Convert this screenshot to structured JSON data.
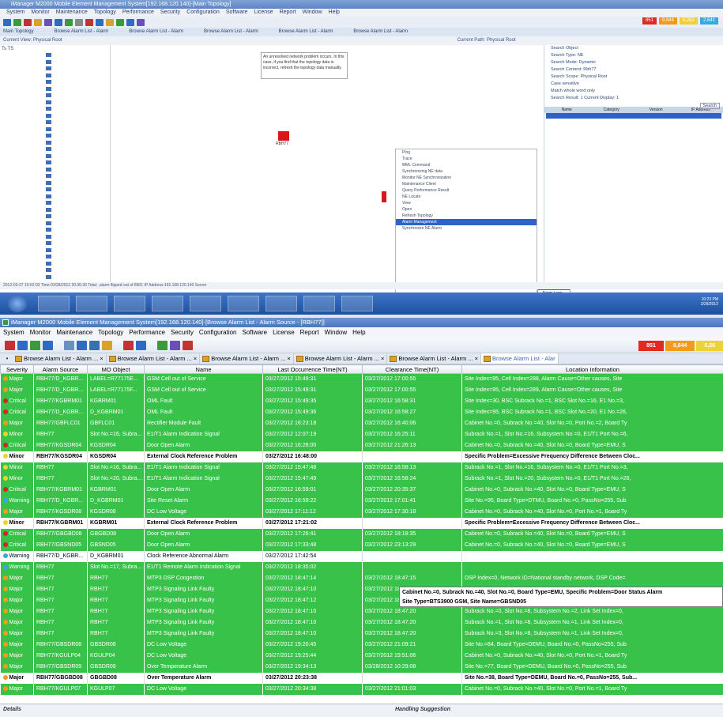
{
  "bg": {
    "title": "iManager M2000 Mobile Element Management System[192.168.120.140]-[Main Topology]",
    "menu": [
      "System",
      "Monitor",
      "Maintenance",
      "Topology",
      "Performance",
      "Security",
      "Configuration",
      "Software",
      "License",
      "Report",
      "Window",
      "Help"
    ],
    "counters": [
      "851",
      "9,844",
      "5,262",
      "2,641"
    ],
    "tabs": [
      "Main Topology",
      "Browse Alarm List - Alarm",
      "Browse Alarm List - Alarm",
      "Browse Alarm List - Alarm",
      "Browse Alarm List - Alarm",
      "Browse Alarm List - Alarm"
    ],
    "view_label": "Current View: Physical Root",
    "path_label": "Current Path: Physical Root",
    "note": "An unresolved network problem occurs. In this case, if you find that the topology data is incorrect, refresh the topology data manually.",
    "ne_label": "RBH77",
    "tree_root": "Ts TS",
    "ctx_items": [
      "Ping",
      "Trace",
      "MML Command",
      "Synchronizing NE data",
      "Monitor NE Synchronization",
      "Maintenance Client",
      "Query Performance Result",
      "NE Locate",
      "View",
      "Open",
      "Refresh Topology",
      "Alarm Management",
      "Synchronize NE Alarm"
    ],
    "submenu": [
      "Alarm List",
      "Alarm Logs",
      "Event Logs"
    ],
    "search_rows": [
      "Search Object",
      "Search Type: NE",
      "Search Mode: Dynamic",
      "Search Content: Rbh77",
      "Search Scope: Physical Root",
      "Case sensitive",
      "Match whole word only",
      "Search Result: 1  Current Display: 1"
    ],
    "search_button": "Search",
    "search_headers": [
      "Name",
      "Category",
      "Version",
      "IP Address"
    ],
    "status": "2012-03-27 15:52:03  Time:03/28/2012 20:35:30  Total: ,alarm flipped out of 8901  IP Address:192.168.120.140  Server",
    "tray_time": "10:23 PM",
    "tray_date": "3/28/2012"
  },
  "window": {
    "title": "iManager M2000 Mobile Element Management System[192.168.120.140]-[Browse Alarm List - Alarm Source - [RBH77]]",
    "menu": [
      "System",
      "Monitor",
      "Maintenance",
      "Topology",
      "Performance",
      "Security",
      "Configuration",
      "Software",
      "License",
      "Report",
      "Window",
      "Help"
    ],
    "counters": [
      {
        "value": "851",
        "color": "#e02a20"
      },
      {
        "value": "9,844",
        "color": "#f39a1b"
      },
      {
        "value": "5,26",
        "color": "#ecd23a"
      }
    ],
    "tabs": [
      "Browse Alarm List - Alarm ...",
      "Browse Alarm List - Alarm ...",
      "Browse Alarm List - Alarm ...",
      "Browse Alarm List - Alarm ...",
      "Browse Alarm List - Alarm ...",
      "Browse Alarm List - Alar"
    ],
    "icons": [
      "alarm-bell-icon",
      "filter-icon",
      "refresh-icon",
      "topology-icon",
      "search-icon",
      "acknowledge-icon",
      "clear-icon",
      "export-icon",
      "print-icon",
      "chart-icon",
      "settings-icon",
      "table-icon",
      "flag-icon"
    ]
  },
  "table": {
    "columns": [
      "Severity",
      "Alarm Source",
      "MO Object",
      "Name",
      "Last Occurrence Time(NT)",
      "Clearance Time(NT)",
      "Location Information"
    ],
    "rows": [
      {
        "sev": "Major",
        "src": "RBH77/D_KGBR...",
        "mo": "LABEL=R77175E...",
        "name": "GSM Cell out of Service",
        "last": "03/27/2012 15:49:31",
        "clear": "03/27/2012 17:00:55",
        "loc": "Site Index=95, Cell Index=288, Alarm Cause=Other causes, Site",
        "style": "g"
      },
      {
        "sev": "Major",
        "src": "RBH77/D_KGBR...",
        "mo": "LABEL=R77175F...",
        "name": "GSM Cell out of Service",
        "last": "03/27/2012 15:49:31",
        "clear": "03/27/2012 17:00:55",
        "loc": "Site Index=95, Cell Index=289, Alarm Cause=Other causes, Site",
        "style": "g"
      },
      {
        "sev": "Critical",
        "src": "RBH77/KGBRM01",
        "mo": "KGBRM01",
        "name": "OML Fault",
        "last": "03/27/2012 15:49:35",
        "clear": "03/27/2012 16:58:31",
        "loc": "Site Index=30, BSC Subrack No.=1, BSC Slot No.=16, E1 No.=3,",
        "style": "g"
      },
      {
        "sev": "Critical",
        "src": "RBH77/D_KGBR...",
        "mo": "D_KGBRM01",
        "name": "OML Fault",
        "last": "03/27/2012 15:49:36",
        "clear": "03/27/2012 16:58:27",
        "loc": "Site Index=95, BSC Subrack No.=1, BSC Slot No.=20, E1 No.=26,",
        "style": "g"
      },
      {
        "sev": "Major",
        "src": "RBH77/GBFLC01",
        "mo": "GBFLC01",
        "name": "Rectifier Module Fault",
        "last": "03/27/2012 16:23:18",
        "clear": "03/27/2012 16:40:06",
        "loc": "Cabinet No.=0, Subrack No.=40, Slot No.=0, Port No.=2, Board Ty",
        "style": "g"
      },
      {
        "sev": "Minor",
        "src": "RBH77",
        "mo": "Slot No.=16, Subra...",
        "name": "E1/T1 Alarm Indication Signal",
        "last": "03/27/2012 12:07:19",
        "clear": "03/27/2012 16:25:11",
        "loc": "Subrack No.=1, Slot No.=16, Subsystem No.=0, E1/T1 Port No.=6,",
        "style": "g"
      },
      {
        "sev": "Critical",
        "src": "RBH77/KGSDR04",
        "mo": "KGSDR04",
        "name": "Door Open Alarm",
        "last": "03/27/2012 16:28:00",
        "clear": "03/27/2012 21:26:13",
        "loc": "Cabinet No.=0, Subrack No.=40, Slot No.=0, Board Type=EMU, S",
        "style": "g"
      },
      {
        "sev": "Minor",
        "src": "RBH77/KGSDR04",
        "mo": "KGSDR04",
        "name": "External Clock Reference Problem",
        "last": "03/27/2012 16:48:00",
        "clear": "",
        "loc": "Specific Problem=Excessive Frequency Difference Between Cloc...",
        "style": "w"
      },
      {
        "sev": "Minor",
        "src": "RBH77",
        "mo": "Slot No.=16, Subra...",
        "name": "E1/T1 Alarm Indication Signal",
        "last": "03/27/2012 15:47:48",
        "clear": "03/27/2012 16:58:13",
        "loc": "Subrack No.=1, Slot No.=16, Subsystem No.=0, E1/T1 Port No.=3,",
        "style": "g"
      },
      {
        "sev": "Minor",
        "src": "RBH77",
        "mo": "Slot No.=20, Subra...",
        "name": "E1/T1 Alarm Indication Signal",
        "last": "03/27/2012 15:47:49",
        "clear": "03/27/2012 16:58:24",
        "loc": "Subrack No.=1, Slot No.=20, Subsystem No.=0, E1/T1 Port No.=26,",
        "style": "g"
      },
      {
        "sev": "Critical",
        "src": "RBH77/KGBRM01",
        "mo": "KGBRM01",
        "name": "Door Open Alarm",
        "last": "03/27/2012 16:59:01",
        "clear": "03/27/2012 20:35:37",
        "loc": "Cabinet No.=0, Subrack No.=40, Slot No.=0, Board Type=EMU, S",
        "style": "g"
      },
      {
        "sev": "Warning",
        "src": "RBH77/D_KGBR...",
        "mo": "D_KGBRM01",
        "name": "Site Reset Alarm",
        "last": "03/27/2012 16:59:22",
        "clear": "03/27/2012 17:01:41",
        "loc": "Site No.=95, Board Type=DTMU, Board No.=0, PassNo=255, Sub",
        "style": "g"
      },
      {
        "sev": "Major",
        "src": "RBH77/KGSDR08",
        "mo": "KGSDR08",
        "name": "DC Low Voltage",
        "last": "03/27/2012 17:11:12",
        "clear": "03/27/2012 17:30:18",
        "loc": "Cabinet No.=0, Subrack No.=40, Slot No.=0, Port No.=1, Board Ty",
        "style": "g"
      },
      {
        "sev": "Minor",
        "src": "RBH77/KGBRM01",
        "mo": "KGBRM01",
        "name": "External Clock Reference Problem",
        "last": "03/27/2012 17:21:02",
        "clear": "",
        "loc": "Specific Problem=Excessive Frequency Difference Between Cloc...",
        "style": "w"
      },
      {
        "sev": "Critical",
        "src": "RBH77/GBGBD08",
        "mo": "GBGBD08",
        "name": "Door Open Alarm",
        "last": "03/27/2012 17:26:41",
        "clear": "03/27/2012 18:18:35",
        "loc": "Cabinet No.=0, Subrack No.=40, Slot No.=0, Board Type=EMU, S",
        "style": "g"
      },
      {
        "sev": "Critical",
        "src": "RBH77/GBSND05",
        "mo": "GBSND05",
        "name": "Door Open Alarm",
        "last": "03/27/2012 17:33:48",
        "clear": "03/27/2012 23:13:29",
        "loc": "Cabinet No.=0, Subrack No.=40, Slot No.=0, Board Type=EMU, S",
        "style": "g"
      },
      {
        "sev": "Warning",
        "src": "RBH77/D_KGBR...",
        "mo": "D_KGBRM01",
        "name": "Clock Reference Abnormal Alarm",
        "last": "03/27/2012 17:42:54",
        "clear": "",
        "loc": "",
        "style": "w sel"
      },
      {
        "sev": "Warning",
        "src": "RBH77",
        "mo": "Slot No.=17, Subra...",
        "name": "E1/T1 Remote Alarm Indication Signal",
        "last": "03/27/2012 18:35:02",
        "clear": "",
        "loc": "",
        "style": "g"
      },
      {
        "sev": "Major",
        "src": "RBH77",
        "mo": "RBH77",
        "name": "MTP3 DSP Congestion",
        "last": "03/27/2012 18:47:14",
        "clear": "03/27/2012 18:47:15",
        "loc": "DSP Index=0, Network ID=National standby network, DSP Code=",
        "style": "g"
      },
      {
        "sev": "Major",
        "src": "RBH77",
        "mo": "RBH77",
        "name": "MTP3 Signaling Link Faulty",
        "last": "03/27/2012 18:47:10",
        "clear": "03/27/2012 18:47:20",
        "loc": "Subrack No.=0, Slot No.=8, Subsystem No.=0, Link Set Index=0,",
        "style": "g"
      },
      {
        "sev": "Major",
        "src": "RBH77",
        "mo": "RBH77",
        "name": "MTP3 Signaling Link Faulty",
        "last": "03/27/2012 18:47:12",
        "clear": "03/27/2012 18:47:22",
        "loc": "Subrack No.=0, Slot No.=8, Subsystem No.=1, Link Set Index=0,",
        "style": "g"
      },
      {
        "sev": "Major",
        "src": "RBH77",
        "mo": "RBH77",
        "name": "MTP3 Signaling Link Faulty",
        "last": "03/27/2012 18:47:10",
        "clear": "03/27/2012 18:47:20",
        "loc": "Subrack No.=0, Slot No.=8, Subsystem No.=2, Link Set Index=0,",
        "style": "g"
      },
      {
        "sev": "Major",
        "src": "RBH77",
        "mo": "RBH77",
        "name": "MTP3 Signaling Link Faulty",
        "last": "03/27/2012 18:47:10",
        "clear": "03/27/2012 18:47:20",
        "loc": "Subrack No.=1, Slot No.=8, Subsystem No.=1, Link Set Index=0,",
        "style": "g"
      },
      {
        "sev": "Major",
        "src": "RBH77",
        "mo": "RBH77",
        "name": "MTP3 Signaling Link Faulty",
        "last": "03/27/2012 18:47:10",
        "clear": "03/27/2012 18:47:20",
        "loc": "Subrack No.=3, Slot No.=8, Subsystem No.=1, Link Set Index=0,",
        "style": "g"
      },
      {
        "sev": "Major",
        "src": "RBH77/GBSDR08",
        "mo": "GBSDR08",
        "name": "DC Low Voltage",
        "last": "03/27/2012 19:20:45",
        "clear": "03/27/2012 21:09:21",
        "loc": "Site No.=84, Board Type=DEMU, Board No.=0, PassNo=255, Sub",
        "style": "g"
      },
      {
        "sev": "Major",
        "src": "RBH77/KGULP04",
        "mo": "KGULP04",
        "name": "DC Low Voltage",
        "last": "03/27/2012 19:25:44",
        "clear": "03/27/2012 19:51:06",
        "loc": "Cabinet No.=0, Subrack No.=40, Slot No.=0, Port No.=1, Board Ty",
        "style": "g"
      },
      {
        "sev": "Major",
        "src": "RBH77/GBSDR09",
        "mo": "GBSDR09",
        "name": "Over Temperature Alarm",
        "last": "03/27/2012 19:34:13",
        "clear": "03/28/2012 10:29:08",
        "loc": "Site No.=77, Board Type=DEMU, Board No.=0, PassNo=255, Sub",
        "style": "g"
      },
      {
        "sev": "Major",
        "src": "RBH77/GBGBD08",
        "mo": "GBGBD08",
        "name": "Over Temperature Alarm",
        "last": "03/27/2012 20:23:38",
        "clear": "",
        "loc": "Site No.=38, Board Type=DEMU, Board No.=0, PassNo=255, Sub...",
        "style": "w"
      },
      {
        "sev": "Major",
        "src": "RBH77/KGULP07",
        "mo": "KGULP07",
        "name": "DC Low Voltage",
        "last": "03/27/2012 20:34:38",
        "clear": "03/27/2012 21:01:03",
        "loc": "Cabinet No.=0, Subrack No.=40, Slot No.=0, Port No.=1, Board Ty",
        "style": "g"
      }
    ]
  },
  "tooltip": {
    "line1": "Cabinet No.=0, Subrack No.=40, Slot No.=0, Board Type=EMU, Specific Problem=Door Status Alarm",
    "line2": "Site Type=BTS3900 GSM, Site Name=GBSND05"
  },
  "bottom": {
    "details": "Details",
    "handling": "Handling Suggestion"
  },
  "colors": {
    "green_row": "#38c24a",
    "critical": "#e1201c",
    "major": "#f39a1b",
    "minor": "#e8d825",
    "warning": "#36a9e0"
  }
}
